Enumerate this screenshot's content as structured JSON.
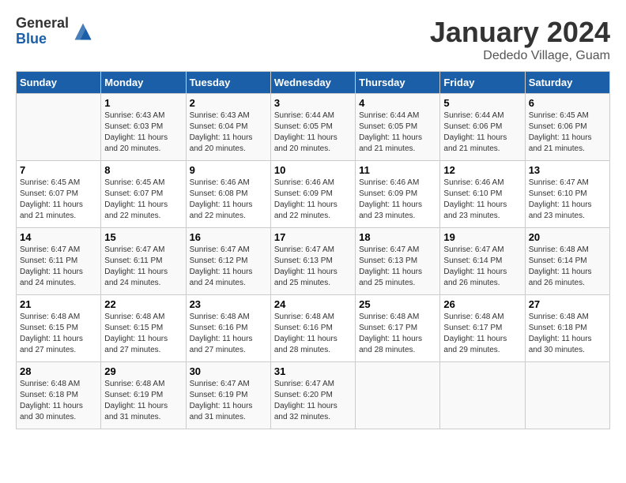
{
  "logo": {
    "general": "General",
    "blue": "Blue"
  },
  "title": {
    "month": "January 2024",
    "location": "Dededo Village, Guam"
  },
  "headers": [
    "Sunday",
    "Monday",
    "Tuesday",
    "Wednesday",
    "Thursday",
    "Friday",
    "Saturday"
  ],
  "weeks": [
    [
      {
        "day": "",
        "info": ""
      },
      {
        "day": "1",
        "info": "Sunrise: 6:43 AM\nSunset: 6:03 PM\nDaylight: 11 hours\nand 20 minutes."
      },
      {
        "day": "2",
        "info": "Sunrise: 6:43 AM\nSunset: 6:04 PM\nDaylight: 11 hours\nand 20 minutes."
      },
      {
        "day": "3",
        "info": "Sunrise: 6:44 AM\nSunset: 6:05 PM\nDaylight: 11 hours\nand 20 minutes."
      },
      {
        "day": "4",
        "info": "Sunrise: 6:44 AM\nSunset: 6:05 PM\nDaylight: 11 hours\nand 21 minutes."
      },
      {
        "day": "5",
        "info": "Sunrise: 6:44 AM\nSunset: 6:06 PM\nDaylight: 11 hours\nand 21 minutes."
      },
      {
        "day": "6",
        "info": "Sunrise: 6:45 AM\nSunset: 6:06 PM\nDaylight: 11 hours\nand 21 minutes."
      }
    ],
    [
      {
        "day": "7",
        "info": "Sunrise: 6:45 AM\nSunset: 6:07 PM\nDaylight: 11 hours\nand 21 minutes."
      },
      {
        "day": "8",
        "info": "Sunrise: 6:45 AM\nSunset: 6:07 PM\nDaylight: 11 hours\nand 22 minutes."
      },
      {
        "day": "9",
        "info": "Sunrise: 6:46 AM\nSunset: 6:08 PM\nDaylight: 11 hours\nand 22 minutes."
      },
      {
        "day": "10",
        "info": "Sunrise: 6:46 AM\nSunset: 6:09 PM\nDaylight: 11 hours\nand 22 minutes."
      },
      {
        "day": "11",
        "info": "Sunrise: 6:46 AM\nSunset: 6:09 PM\nDaylight: 11 hours\nand 23 minutes."
      },
      {
        "day": "12",
        "info": "Sunrise: 6:46 AM\nSunset: 6:10 PM\nDaylight: 11 hours\nand 23 minutes."
      },
      {
        "day": "13",
        "info": "Sunrise: 6:47 AM\nSunset: 6:10 PM\nDaylight: 11 hours\nand 23 minutes."
      }
    ],
    [
      {
        "day": "14",
        "info": "Sunrise: 6:47 AM\nSunset: 6:11 PM\nDaylight: 11 hours\nand 24 minutes."
      },
      {
        "day": "15",
        "info": "Sunrise: 6:47 AM\nSunset: 6:11 PM\nDaylight: 11 hours\nand 24 minutes."
      },
      {
        "day": "16",
        "info": "Sunrise: 6:47 AM\nSunset: 6:12 PM\nDaylight: 11 hours\nand 24 minutes."
      },
      {
        "day": "17",
        "info": "Sunrise: 6:47 AM\nSunset: 6:13 PM\nDaylight: 11 hours\nand 25 minutes."
      },
      {
        "day": "18",
        "info": "Sunrise: 6:47 AM\nSunset: 6:13 PM\nDaylight: 11 hours\nand 25 minutes."
      },
      {
        "day": "19",
        "info": "Sunrise: 6:47 AM\nSunset: 6:14 PM\nDaylight: 11 hours\nand 26 minutes."
      },
      {
        "day": "20",
        "info": "Sunrise: 6:48 AM\nSunset: 6:14 PM\nDaylight: 11 hours\nand 26 minutes."
      }
    ],
    [
      {
        "day": "21",
        "info": "Sunrise: 6:48 AM\nSunset: 6:15 PM\nDaylight: 11 hours\nand 27 minutes."
      },
      {
        "day": "22",
        "info": "Sunrise: 6:48 AM\nSunset: 6:15 PM\nDaylight: 11 hours\nand 27 minutes."
      },
      {
        "day": "23",
        "info": "Sunrise: 6:48 AM\nSunset: 6:16 PM\nDaylight: 11 hours\nand 27 minutes."
      },
      {
        "day": "24",
        "info": "Sunrise: 6:48 AM\nSunset: 6:16 PM\nDaylight: 11 hours\nand 28 minutes."
      },
      {
        "day": "25",
        "info": "Sunrise: 6:48 AM\nSunset: 6:17 PM\nDaylight: 11 hours\nand 28 minutes."
      },
      {
        "day": "26",
        "info": "Sunrise: 6:48 AM\nSunset: 6:17 PM\nDaylight: 11 hours\nand 29 minutes."
      },
      {
        "day": "27",
        "info": "Sunrise: 6:48 AM\nSunset: 6:18 PM\nDaylight: 11 hours\nand 30 minutes."
      }
    ],
    [
      {
        "day": "28",
        "info": "Sunrise: 6:48 AM\nSunset: 6:18 PM\nDaylight: 11 hours\nand 30 minutes."
      },
      {
        "day": "29",
        "info": "Sunrise: 6:48 AM\nSunset: 6:19 PM\nDaylight: 11 hours\nand 31 minutes."
      },
      {
        "day": "30",
        "info": "Sunrise: 6:47 AM\nSunset: 6:19 PM\nDaylight: 11 hours\nand 31 minutes."
      },
      {
        "day": "31",
        "info": "Sunrise: 6:47 AM\nSunset: 6:20 PM\nDaylight: 11 hours\nand 32 minutes."
      },
      {
        "day": "",
        "info": ""
      },
      {
        "day": "",
        "info": ""
      },
      {
        "day": "",
        "info": ""
      }
    ]
  ]
}
